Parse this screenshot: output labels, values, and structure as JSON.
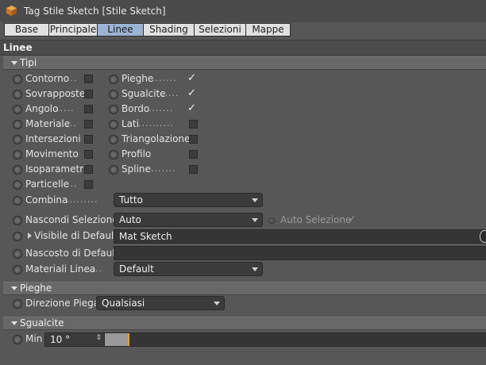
{
  "window": {
    "title": "Tag Stile Sketch [Stile Sketch]"
  },
  "tabs": [
    "Base",
    "Principale",
    "Linee",
    "Shading",
    "Selezioni",
    "Mappe"
  ],
  "active_tab": "Linee",
  "section_title": "Linee",
  "groups": {
    "tipi": "Tipi",
    "pieghe": "Pieghe",
    "sgualcite": "Sgualcite"
  },
  "left_options": [
    {
      "label": "Contorno",
      "dots": "...",
      "checked": false
    },
    {
      "label": "Sovrapposte",
      "dots": "",
      "checked": false
    },
    {
      "label": "Angolo",
      "dots": ".....",
      "checked": false
    },
    {
      "label": "Materiale",
      "dots": "...",
      "checked": false
    },
    {
      "label": "Intersezioni",
      "dots": "",
      "checked": false
    },
    {
      "label": "Movimento",
      "dots": "",
      "checked": false
    },
    {
      "label": "Isoparametri",
      "dots": "",
      "checked": false
    },
    {
      "label": "Particelle",
      "dots": "...",
      "checked": false
    }
  ],
  "right_options": [
    {
      "label": "Pieghe",
      "dots": ".......",
      "checked": true
    },
    {
      "label": "Sgualcite",
      "dots": ".....",
      "checked": true
    },
    {
      "label": "Bordo",
      "dots": ".......",
      "checked": true
    },
    {
      "label": "Lati",
      "dots": "..........",
      "checked": false
    },
    {
      "label": "Triangolazione",
      "dots": "",
      "checked": false
    },
    {
      "label": "Profilo",
      "dots": "",
      "checked": false
    },
    {
      "label": "Spline",
      "dots": ".......",
      "checked": false
    }
  ],
  "combina": {
    "label": "Combina",
    "dots": ".........",
    "value": "Tutto"
  },
  "nascondi": {
    "label": "Nascondi Selezione",
    "value": "Auto",
    "auto_label": "Auto Selezione",
    "auto_checked": true
  },
  "visibile": {
    "label": "Visibile di Default",
    "value": "Mat Sketch"
  },
  "nascosto": {
    "label": "Nascosto di Default",
    "value": ""
  },
  "materiali": {
    "label": "Materiali Linea",
    "dots": "....",
    "value": "Default"
  },
  "direzione": {
    "label": "Direzione Piega",
    "value": "Qualsiasi"
  },
  "min": {
    "label": "Min",
    "value": "10 °",
    "slider_fraction": 0.06
  },
  "icons": {
    "title_icon": "cube-icon",
    "check_glyph": "✓"
  },
  "colors": {
    "accent_tab": "#9cb4d4",
    "slider_marker": "#f0a020"
  }
}
